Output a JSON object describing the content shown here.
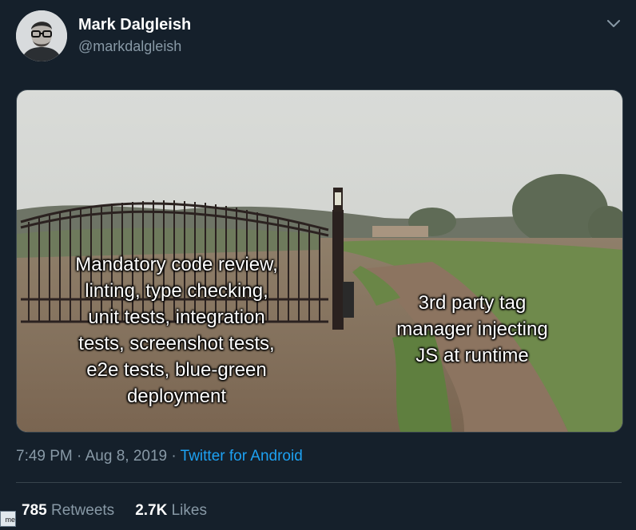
{
  "tweet": {
    "author_name": "Mark Dalgleish",
    "author_handle": "@markdalgleish",
    "menu_icon": "chevron-down-icon",
    "media": {
      "left_text": "Mandatory code review,\nlinting, type checking,\nunit tests, integration\ntests, screenshot tests,\ne2e tests, blue-green\ndeployment",
      "right_text": "3rd party tag\nmanager injecting\nJS at runtime"
    },
    "time": "7:49 PM",
    "date": "Aug 8, 2019",
    "separator": "·",
    "source": "Twitter for Android",
    "retweets_count": "785",
    "retweets_label": "Retweets",
    "likes_count": "2.7K",
    "likes_label": "Likes"
  },
  "corner_tag": "me",
  "colors": {
    "background": "#15202b",
    "secondary_text": "#8899a6",
    "link": "#1da1f2",
    "divider": "#38444d"
  }
}
